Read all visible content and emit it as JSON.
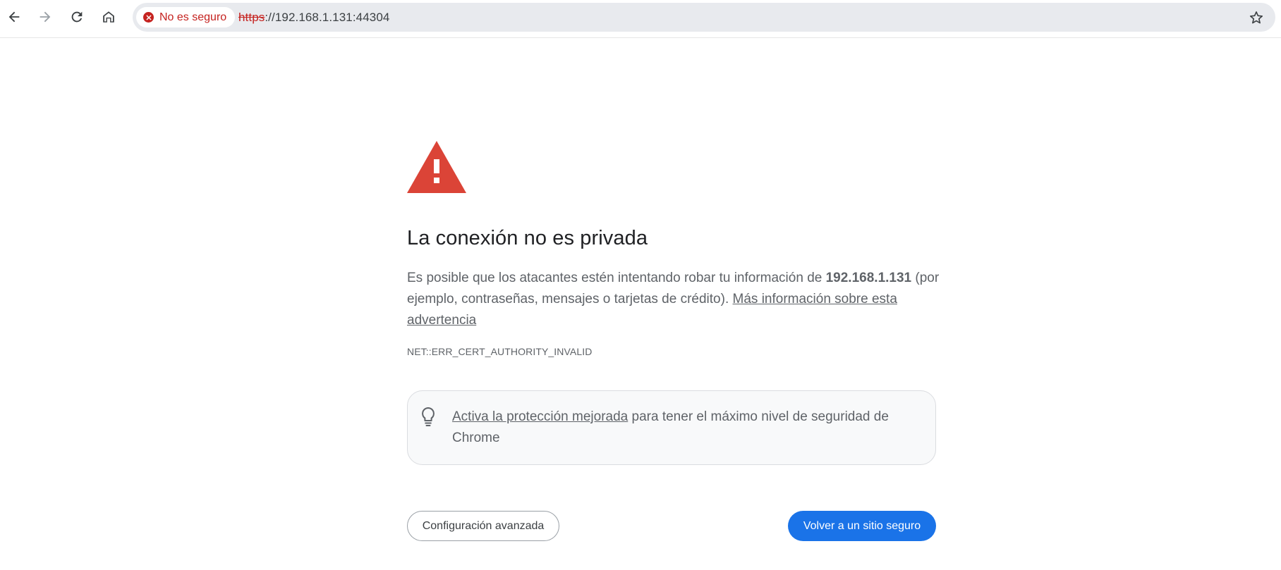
{
  "browser": {
    "nav_icons": {
      "back": "arrow-left-icon",
      "forward": "arrow-right-icon",
      "reload": "reload-icon",
      "home": "home-icon",
      "bookmark": "star-icon"
    },
    "security_chip": {
      "label": "No es seguro",
      "icon": "error-circle-icon",
      "color": "#c5221f"
    },
    "url": {
      "scheme": "https",
      "rest": "://192.168.1.131:44304"
    }
  },
  "interstitial": {
    "warning_icon": "warning-triangle-icon",
    "warning_color": "#db4437",
    "heading": "La conexión no es privada",
    "explanation": {
      "before_host": "Es posible que los atacantes estén intentando robar tu información de ",
      "host": "192.168.1.131",
      "after_host": " (por ejemplo, contraseñas, mensajes o tarjetas de crédito). ",
      "learn_more_link": "Más información sobre esta advertencia"
    },
    "error_code": "NET::ERR_CERT_AUTHORITY_INVALID",
    "enhanced_protection": {
      "icon": "lightbulb-icon",
      "link": "Activa la protección mejorada",
      "text": " para tener el máximo nivel de seguridad de Chrome"
    },
    "buttons": {
      "advanced": "Configuración avanzada",
      "back_to_safety": "Volver a un sitio seguro"
    },
    "accent_color": "#1a73e8"
  }
}
